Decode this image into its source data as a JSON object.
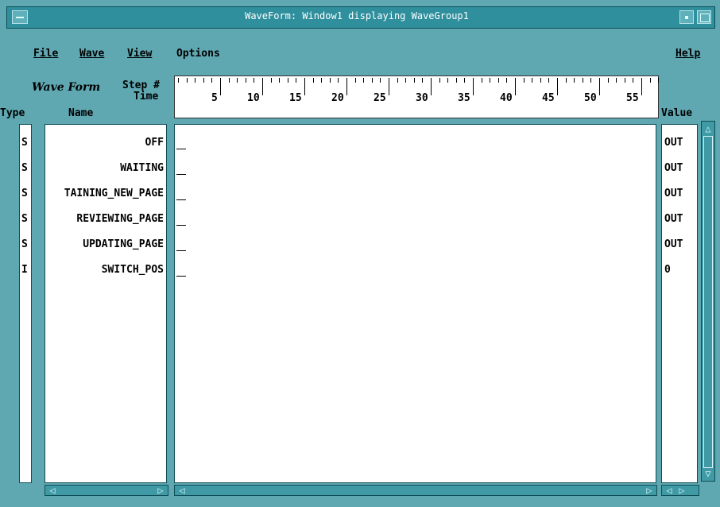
{
  "window": {
    "title": "WaveForm: Window1 displaying WaveGroup1"
  },
  "menu": {
    "file": "File",
    "wave": "Wave",
    "view": "View",
    "options": "Options",
    "help": "Help"
  },
  "header": {
    "waveform": "Wave Form",
    "step": "Step #",
    "time": "Time",
    "type": "Type",
    "name": "Name",
    "value": "Value"
  },
  "ruler": {
    "labels": [
      "5",
      "10",
      "15",
      "20",
      "25",
      "30",
      "35",
      "40",
      "45",
      "50",
      "55"
    ]
  },
  "signals": [
    {
      "type": "S",
      "name": "OFF",
      "value": "OUT"
    },
    {
      "type": "S",
      "name": "WAITING",
      "value": "OUT"
    },
    {
      "type": "S",
      "name": "TAINING_NEW_PAGE",
      "value": "OUT"
    },
    {
      "type": "S",
      "name": "REVIEWING_PAGE",
      "value": "OUT"
    },
    {
      "type": "S",
      "name": "UPDATING_PAGE",
      "value": "OUT"
    },
    {
      "type": "I",
      "name": "SWITCH_POS",
      "value": "0"
    }
  ],
  "icons": {
    "left": "left-arrow-icon",
    "right": "right-arrow-icon",
    "up": "up-arrow-icon",
    "down": "down-arrow-icon"
  }
}
